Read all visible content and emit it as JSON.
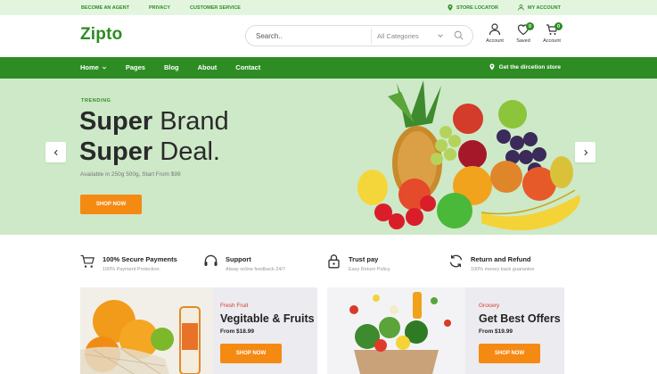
{
  "topbar": {
    "links": [
      "BECOME AN AGENT",
      "PRIVACY",
      "CUSTOMER SERVICE"
    ],
    "store_locator": "STORE LOCATOR",
    "my_account": "MY ACCOUNT"
  },
  "header": {
    "logo": "Zipto",
    "search_placeholder": "Search..",
    "category": "All Categories",
    "icons": [
      {
        "label": "Account",
        "icon": "user-icon"
      },
      {
        "label": "Saved",
        "icon": "heart-icon",
        "badge": "0"
      },
      {
        "label": "Account",
        "icon": "cart-icon",
        "badge": "0"
      }
    ]
  },
  "nav": {
    "items": [
      "Home",
      "Pages",
      "Blog",
      "About",
      "Contact"
    ],
    "store_link": "Get the dircetion store"
  },
  "hero": {
    "tag": "TRENDING",
    "line1_bold": "Super",
    "line1_rest": " Brand",
    "line2_bold": "Super",
    "line2_rest": " Deal.",
    "subtitle": "Available in 250g 500g, Start From $99",
    "button": "SHOP NOW"
  },
  "features": [
    {
      "title": "100% Secure Payments",
      "sub": "100% Payment Protection.",
      "icon": "cart-icon"
    },
    {
      "title": "Support",
      "sub": "Alway online feedback 24/7",
      "icon": "headset-icon"
    },
    {
      "title": "Trust pay",
      "sub": "Easy Return Policy.",
      "icon": "lock-icon"
    },
    {
      "title": "Return and Refund",
      "sub": "100% money back guarantee",
      "icon": "refresh-icon"
    }
  ],
  "promos": [
    {
      "category": "Fresh Fruit",
      "title": "Vegitable & Fruits",
      "price": "From $18.99",
      "button": "SHOP NOW"
    },
    {
      "category": "Grocery",
      "title": "Get Best Offers",
      "price": "From $19.99",
      "button": "SHOP NOW"
    }
  ],
  "colors": {
    "brand": "#2e8c24",
    "accent": "#f58a13",
    "hero_bg": "#cde9c8",
    "topbar_bg": "#e3f5df",
    "promo_bg": "#ececf0",
    "promo_category": "#d23a2a"
  }
}
